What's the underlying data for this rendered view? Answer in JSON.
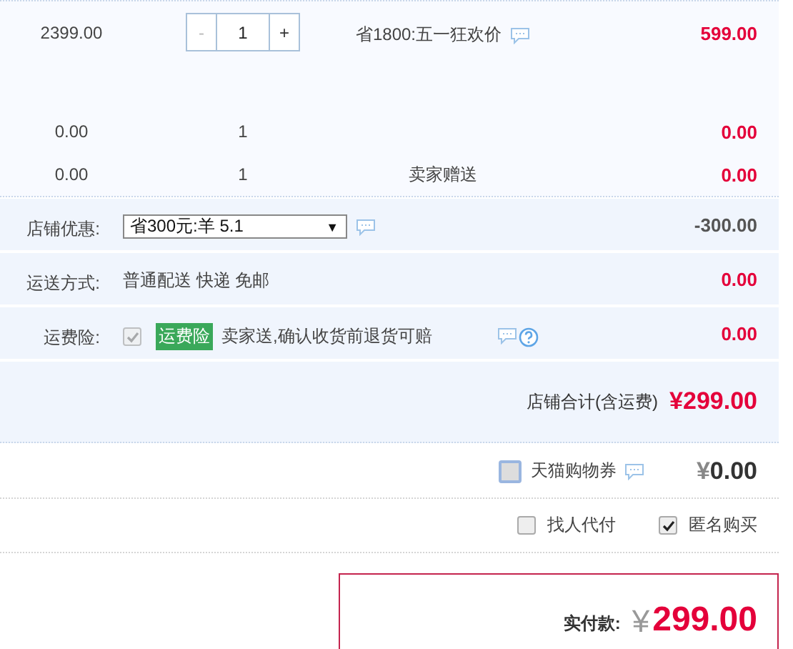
{
  "items": [
    {
      "price": "2399.00",
      "kind": "stepper",
      "stepper": {
        "minus": "-",
        "minus_disabled": true,
        "value": "1",
        "plus": "+"
      },
      "promo": "省1800:五一狂欢价",
      "promo_info": true,
      "subtotal": "599.00"
    },
    {
      "price": "0.00",
      "kind": "text",
      "quantity": "1",
      "subtotal": "0.00"
    },
    {
      "price": "0.00",
      "kind": "text",
      "quantity": "1",
      "promo": "卖家赠送",
      "promo_info": false,
      "subtotal": "0.00"
    }
  ],
  "store": {
    "discount": {
      "label": "店铺优惠:",
      "value": "省300元:羊 5.1",
      "caret": "▼",
      "amount": "-300.00"
    },
    "shipping": {
      "label": "运送方式:",
      "value": "普通配送 快递 免邮",
      "amount": "0.00"
    },
    "insurance": {
      "label": "运费险:",
      "checked": true,
      "disabled": true,
      "badge": "运费险",
      "text": "卖家送,确认收货前退货可赔",
      "amount": "0.00"
    },
    "total": {
      "label": "店铺合计(含运费)",
      "value": "¥299.00"
    }
  },
  "coupon": {
    "checked": false,
    "label": "天猫购物券",
    "currency": "¥",
    "amount": "0.00"
  },
  "options": [
    {
      "label": "找人代付",
      "checked": false
    },
    {
      "label": "匿名购买",
      "checked": true
    }
  ],
  "pay": {
    "label": "实付款:",
    "currency": "¥",
    "amount": "299.00"
  }
}
